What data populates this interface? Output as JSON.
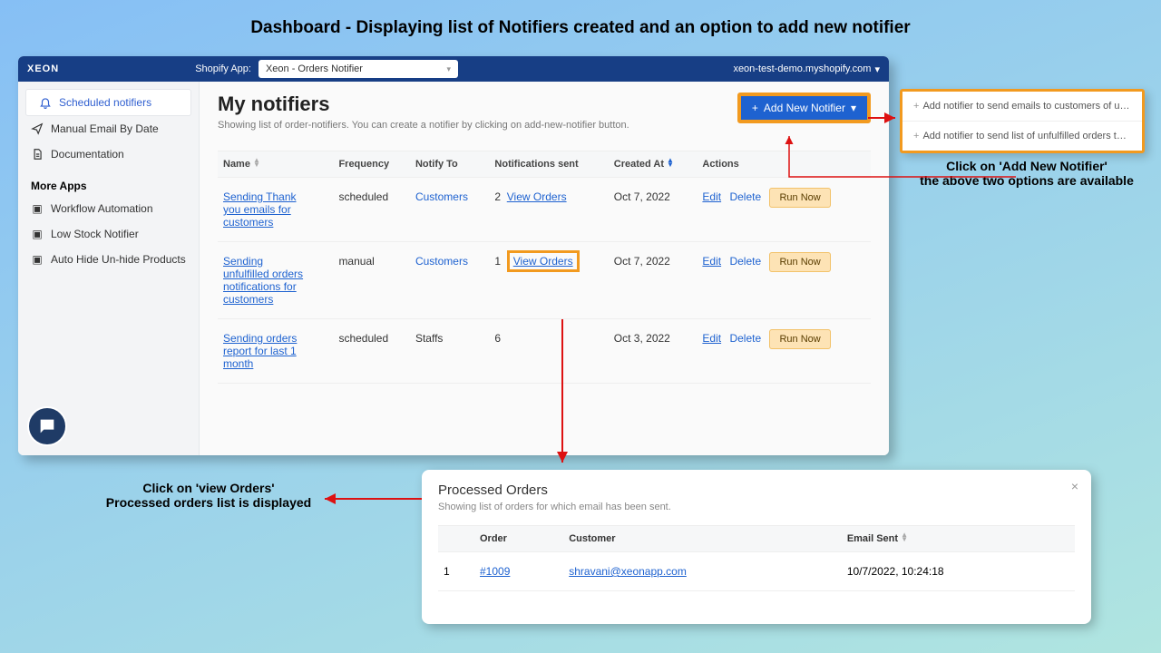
{
  "annotation": {
    "title": "Dashboard - Displaying list of Notifiers created and an option to add new notifier",
    "dropdown_caption_line1": "Click on 'Add New Notifier'",
    "dropdown_caption_line2": "the above two options are available",
    "view_orders_caption_line1": "Click on 'view Orders'",
    "view_orders_caption_line2": "Processed orders list is displayed"
  },
  "topbar": {
    "brand": "XEON",
    "shopify_label": "Shopify App:",
    "selected_app": "Xeon - Orders Notifier",
    "domain": "xeon-test-demo.myshopify.com"
  },
  "sidebar": {
    "items": [
      {
        "label": "Scheduled notifiers",
        "icon": "bell-icon"
      },
      {
        "label": "Manual Email By Date",
        "icon": "send-icon"
      },
      {
        "label": "Documentation",
        "icon": "doc-icon"
      }
    ],
    "more_apps_header": "More Apps",
    "more_apps": [
      {
        "label": "Workflow Automation"
      },
      {
        "label": "Low Stock Notifier"
      },
      {
        "label": "Auto Hide Un-hide Products"
      }
    ]
  },
  "page": {
    "title": "My notifiers",
    "subtitle": "Showing list of order-notifiers. You can create a notifier by clicking on add-new-notifier button.",
    "add_button": "Add New Notifier"
  },
  "dropdown_options": [
    "Add notifier to send emails to customers of unfulfilled orders",
    "Add notifier to send list of unfulfilled orders to staff, admin ..."
  ],
  "table": {
    "headers": {
      "name": "Name",
      "frequency": "Frequency",
      "notify_to": "Notify To",
      "notifications_sent": "Notifications sent",
      "created_at": "Created At",
      "actions": "Actions"
    },
    "actions_labels": {
      "edit": "Edit",
      "delete": "Delete",
      "run": "Run Now",
      "view_orders": "View Orders"
    },
    "rows": [
      {
        "name": "Sending Thank you emails for customers",
        "frequency": "scheduled",
        "notify_to": "Customers",
        "sent": "2",
        "created_at": "Oct 7, 2022"
      },
      {
        "name": "Sending unfulfilled orders notifications for customers",
        "frequency": "manual",
        "notify_to": "Customers",
        "sent": "1",
        "created_at": "Oct 7, 2022"
      },
      {
        "name": "Sending orders report for last 1 month",
        "frequency": "scheduled",
        "notify_to": "Staffs",
        "sent": "6",
        "created_at": "Oct 3, 2022"
      }
    ]
  },
  "processed": {
    "title": "Processed Orders",
    "subtitle": "Showing list of orders for which email has been sent.",
    "headers": {
      "order": "Order",
      "customer": "Customer",
      "email_sent": "Email Sent"
    },
    "rows": [
      {
        "idx": "1",
        "order": "#1009",
        "customer": "shravani@xeonapp.com",
        "email_sent": "10/7/2022, 10:24:18"
      }
    ]
  }
}
